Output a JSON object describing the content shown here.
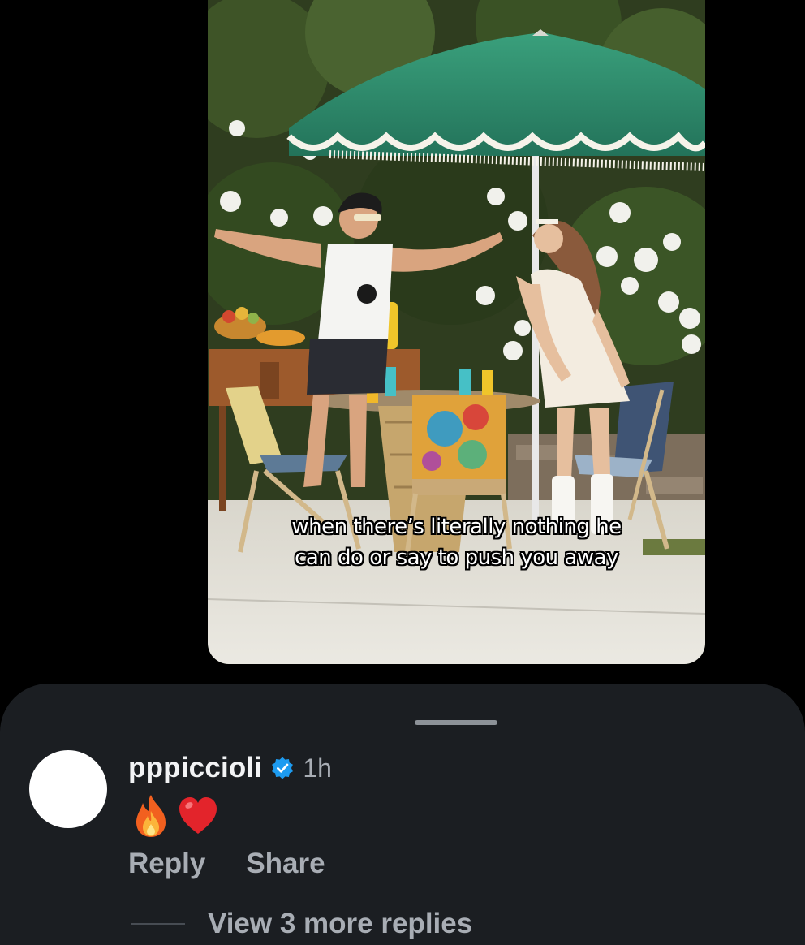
{
  "video": {
    "caption_lines": [
      "when there’s literally nothing he",
      "can do or say to push you away"
    ]
  },
  "comment": {
    "username": "pppiccioli",
    "verified": true,
    "timestamp": "1h",
    "emojis": [
      "fire-emoji",
      "red-heart-emoji"
    ],
    "actions": {
      "reply_label": "Reply",
      "share_label": "Share"
    },
    "view_replies_label": "View 3 more replies"
  },
  "colors": {
    "sheet_background": "#1b1e22",
    "username": "#f2f3f5",
    "secondary_text": "#a8adb4",
    "verified_badge": "#1d9bf0",
    "umbrella_green": "#2f8a6a"
  }
}
